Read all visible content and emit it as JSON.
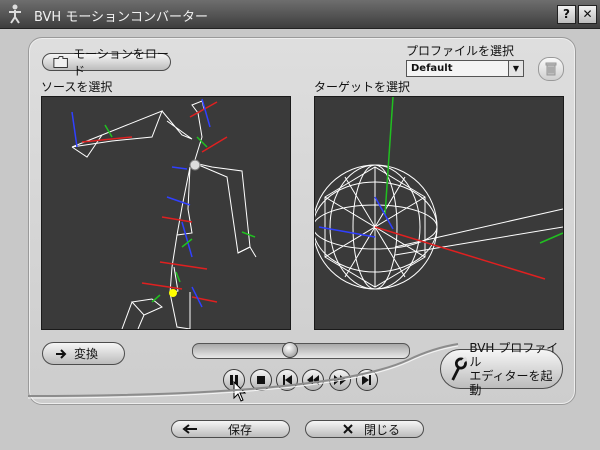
{
  "window": {
    "title": "BVH モーションコンバーター"
  },
  "titlebar": {
    "help_label": "?",
    "close_label": "✕"
  },
  "toolbar": {
    "load_motion_label": "モーションをロード"
  },
  "profile": {
    "label": "プロファイルを選択",
    "selected": "Default"
  },
  "source": {
    "label": "ソースを選択"
  },
  "target": {
    "label": "ターゲットを選択"
  },
  "convert": {
    "label": "変換"
  },
  "playback": {
    "slider_value": 0.44
  },
  "editor_button": {
    "line1": "BVH プロファイル",
    "line2": "エディターを起動"
  },
  "footer": {
    "save_label": "保存",
    "close_label": "閉じる"
  },
  "icons": {
    "app": "figure-icon",
    "folder": "folder-icon",
    "trash": "trash-icon",
    "arrow": "arrow-right-icon",
    "wrench": "wrench-icon",
    "save": "arrow-left-icon",
    "close": "x-icon"
  },
  "colors": {
    "viewport_bg": "#3a3a3a",
    "bone": "#ffffff",
    "axis_red": "#e02020",
    "axis_green": "#20c020",
    "axis_blue": "#3040ff",
    "joint_yellow": "#ffff00"
  }
}
